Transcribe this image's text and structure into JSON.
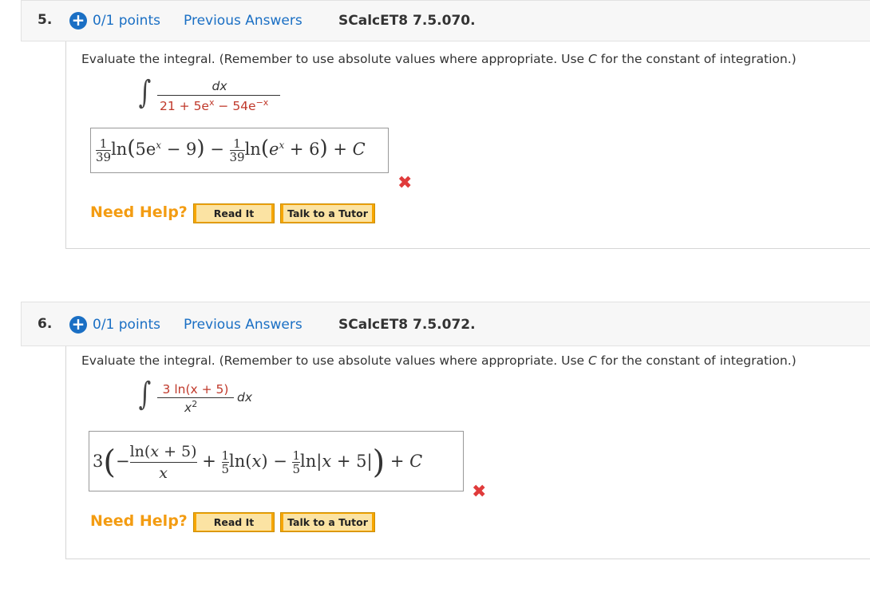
{
  "questions": [
    {
      "number": "5.",
      "points": "0/1 points",
      "previous": "Previous Answers",
      "code": "SCalcET8 7.5.070.",
      "prompt_pre": "Evaluate the integral. (Remember to use absolute values where appropriate. Use ",
      "prompt_c": "C",
      "prompt_post": " for the constant of integration.)",
      "integrand_num": "dx",
      "integrand_den": "21 + 5e",
      "integrand_den_exp1": "x",
      "integrand_den_mid": " − 54e",
      "integrand_den_exp2": "−x",
      "answer": "1/39 ln(5e^x − 9) − 1/39 ln(e^x + 6) + C",
      "status_icon": "x-mark-icon",
      "help_label": "Need Help?",
      "read_it": "Read It",
      "talk_tutor": "Talk to a Tutor"
    },
    {
      "number": "6.",
      "points": "0/1 points",
      "previous": "Previous Answers",
      "code": "SCalcET8 7.5.072.",
      "prompt_pre": "Evaluate the integral. (Remember to use absolute values where appropriate. Use ",
      "prompt_c": "C",
      "prompt_post": " for the constant of integration.)",
      "integrand_num": "3 ln(x + 5)",
      "integrand_den": "x",
      "integrand_den_exp": "2",
      "integrand_tail": "dx",
      "answer": "3(−ln(x+5)/x + 1/5 ln(x) − 1/5 ln|x+5|) + C",
      "status_icon": "x-mark-icon",
      "help_label": "Need Help?",
      "read_it": "Read It",
      "talk_tutor": "Talk to a Tutor"
    }
  ],
  "colors": {
    "link": "#1a6fc4",
    "wrong": "#e03b3b",
    "help": "#f39c12",
    "button": "#f7a600"
  }
}
